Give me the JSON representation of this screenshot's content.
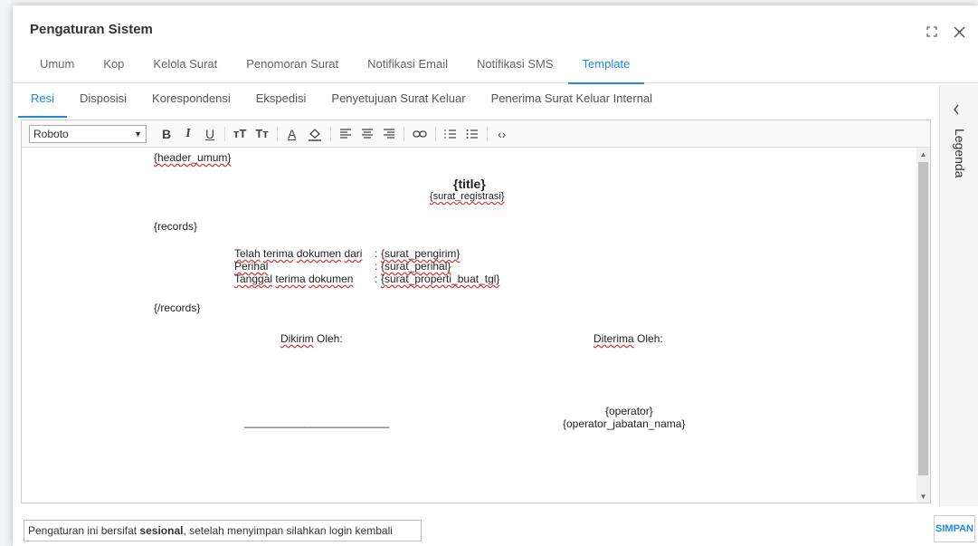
{
  "dialog": {
    "title": "Pengaturan Sistem",
    "main_tabs": [
      "Umum",
      "Kop",
      "Kelola Surat",
      "Penomoran Surat",
      "Notifikasi Email",
      "Notifikasi SMS",
      "Template"
    ],
    "sub_tabs": [
      "Resi",
      "Disposisi",
      "Korespondensi",
      "Ekspedisi",
      "Penyetujuan Surat Keluar",
      "Penerima Surat Keluar Internal"
    ],
    "legend_label": "Legenda"
  },
  "editor": {
    "font": "Roboto",
    "toolbar_icons": [
      "bold-icon",
      "italic-icon",
      "underline-icon",
      "font-size-icon",
      "text-case-icon",
      "font-color-icon",
      "fill-color-icon",
      "align-left-icon",
      "align-center-icon",
      "align-right-icon",
      "link-icon",
      "ordered-list-icon",
      "unordered-list-icon",
      "code-view-icon"
    ],
    "content": {
      "header": "{header_umum}",
      "title": "{title}",
      "surat_registrasi": "{surat_registrasi}",
      "records_open": "{records}",
      "row1_label_1": "Telah",
      "row1_label_2": "terima",
      "row1_label_3": "dokumen",
      "row1_label_4": "dari",
      "row1_sep": ":",
      "row1_value": "{surat_pengirim}",
      "row2_label": "Perihal",
      "row2_sep": ":",
      "row2_value": "{surat_perihal}",
      "row3_label_1": "Tanggal",
      "row3_label_2": "terima",
      "row3_label_3": "dokumen",
      "row3_sep": ":",
      "row3_value": "{surat_properti_buat_tgl}",
      "records_close": "{/records}",
      "sender_label_1": "Dikirim",
      "sender_label_2": "Oleh:",
      "receiver_label_1": "Diterima",
      "receiver_label_2": "Oleh:",
      "signature_line": "________________________",
      "operator": "{operator}",
      "operator_jabatan": "{operator_jabatan_nama}"
    }
  },
  "footer": {
    "note_prefix": "Pengaturan ini bersifat",
    "note_bold": "sesional",
    "note_suffix": ", setelah menyimpan silahkan login kembali",
    "save_label": "SIMPAN"
  },
  "colors": {
    "accent": "#1e88e5",
    "spellcheck": "#dd3333"
  }
}
